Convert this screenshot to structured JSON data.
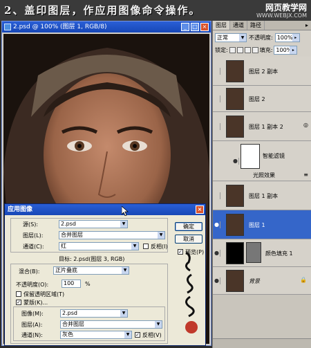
{
  "banner": {
    "title": "2、盖印图层，作应用图像命令操作。",
    "watermark_title": "网页教学网",
    "watermark_url": "WWW.WEBJX.COM"
  },
  "document": {
    "title": "2.psd @ 100% (图层 1, RGB/8)"
  },
  "layers_panel": {
    "tabs": [
      "图层",
      "通道",
      "路径"
    ],
    "blend_mode": "正常",
    "opacity_label": "不透明度:",
    "opacity_value": "100%",
    "lock_label": "锁定:",
    "fill_label": "填充:",
    "fill_value": "100%",
    "layers": [
      {
        "name": "图层 2 副本"
      },
      {
        "name": "图层 2"
      },
      {
        "name": "图层 1 副本 2"
      },
      {
        "name": "智能滤镜"
      },
      {
        "name": "光照效果"
      },
      {
        "name": "图层 1 副本"
      },
      {
        "name": "图层 1"
      },
      {
        "name": "颜色填充 1"
      },
      {
        "name": "背景"
      }
    ]
  },
  "dialog": {
    "title": "应用图像",
    "source_label": "源(S):",
    "source_value": "2.psd",
    "layer_label": "图层(L):",
    "layer_value": "合并图层",
    "channel_label": "通道(C):",
    "channel_value": "红",
    "invert_label": "反相(I)",
    "target_text": "目标:  2.psd(图层 3, RGB)",
    "blend_label": "混合(B):",
    "blend_value": "正片叠底",
    "opacity_label": "不透明度(O):",
    "opacity_value": "100",
    "opacity_unit": "%",
    "preserve_label": "保留透明区域(T)",
    "mask_label": "蒙版(K)...",
    "image_label": "图像(M):",
    "image_value": "2.psd",
    "mask_layer_label": "图层(A):",
    "mask_layer_value": "合并图层",
    "mask_channel_label": "通道(N):",
    "mask_channel_value": "灰色",
    "mask_invert_label": "反相(V)",
    "ok_label": "确定",
    "cancel_label": "取消",
    "preview_label": "预览(P)"
  }
}
